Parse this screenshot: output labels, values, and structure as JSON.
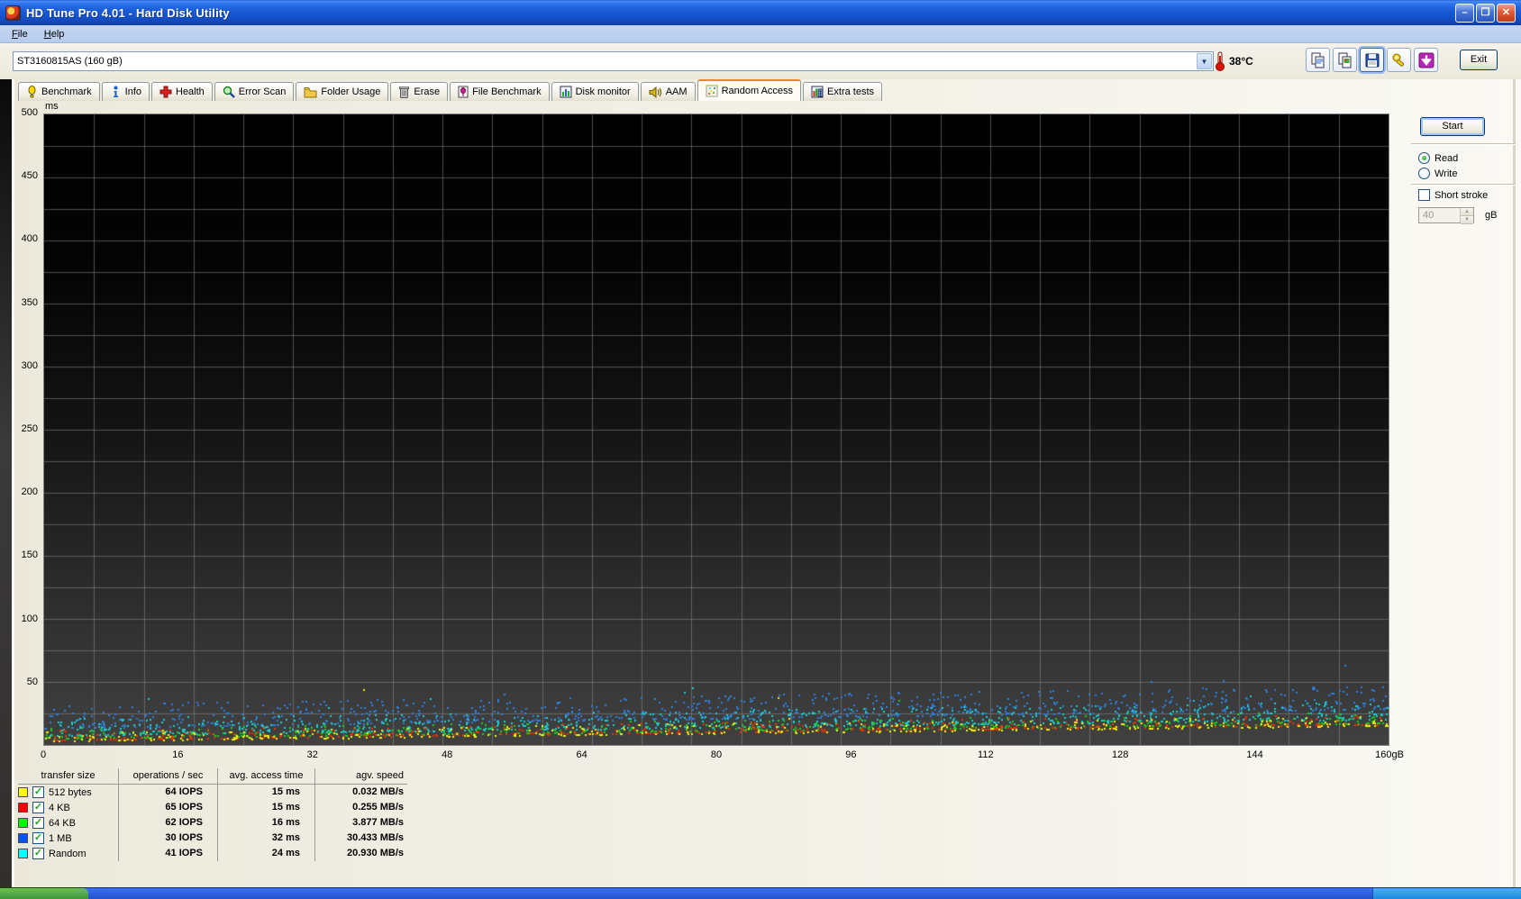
{
  "window": {
    "title": "HD Tune Pro 4.01 - Hard Disk Utility",
    "icons": {
      "app": "hdtune-app-icon",
      "minimize": "minimize-icon",
      "maximize": "maximize-icon",
      "close": "close-icon"
    },
    "glyphs": {
      "minimize": "–",
      "maximize": "❐",
      "close": "✕"
    }
  },
  "menu": {
    "items": [
      {
        "label": "File"
      },
      {
        "label": "Help"
      }
    ]
  },
  "toolbar": {
    "drive_selector": {
      "value": "ST3160815AS (160 gB)"
    },
    "temperature": "38°C",
    "buttons": [
      "copy-text",
      "copy-image",
      "save",
      "options",
      "export"
    ],
    "exit_label": "Exit"
  },
  "tabs": [
    {
      "label": "Benchmark",
      "active": false
    },
    {
      "label": "Info",
      "active": false
    },
    {
      "label": "Health",
      "active": false
    },
    {
      "label": "Error Scan",
      "active": false
    },
    {
      "label": "Folder Usage",
      "active": false
    },
    {
      "label": "Erase",
      "active": false
    },
    {
      "label": "File Benchmark",
      "active": false
    },
    {
      "label": "Disk monitor",
      "active": false
    },
    {
      "label": "AAM",
      "active": false
    },
    {
      "label": "Random Access",
      "active": true
    },
    {
      "label": "Extra tests",
      "active": false
    }
  ],
  "controls": {
    "start_label": "Start",
    "read_label": "Read",
    "write_label": "Write",
    "read_selected": true,
    "short_stroke_label": "Short stroke",
    "short_stroke_checked": false,
    "stroke_value": "40",
    "stroke_unit": "gB"
  },
  "chart_data": {
    "type": "scatter",
    "title": "Random access time vs disk position",
    "y": {
      "label": "ms",
      "min": 0,
      "max": 500,
      "tick_step": 50,
      "grid_step": 25,
      "ticks": [
        500,
        450,
        400,
        350,
        300,
        250,
        200,
        150,
        100,
        50
      ]
    },
    "x": {
      "min": 0,
      "max": 160,
      "tick_step": 16,
      "unit": "gB",
      "ticks": [
        0,
        16,
        32,
        48,
        64,
        80,
        96,
        112,
        128,
        144
      ],
      "end_label": "160gB"
    },
    "grid": {
      "v_divisions": 27,
      "color": "rgba(138,138,138,0.55)"
    },
    "bg_gradient": [
      "#000000",
      "#050505",
      "#141414",
      "#2c2c2c",
      "#414141"
    ],
    "series": [
      {
        "name": "512 bytes",
        "color": "#f2f20e",
        "points": 450,
        "base_start": 2.5,
        "base_end": 15,
        "spread": 8,
        "pow": 2.5,
        "outlier_rate": 0.006,
        "outlier_boost": 35
      },
      {
        "name": "4 KB",
        "color": "#f03000",
        "points": 450,
        "base_start": 3.5,
        "base_end": 16,
        "spread": 8,
        "pow": 2.5,
        "outlier_rate": 0.006,
        "outlier_boost": 35
      },
      {
        "name": "64 KB",
        "color": "#1ad01a",
        "points": 450,
        "base_start": 4.5,
        "base_end": 17,
        "spread": 9,
        "pow": 2.5,
        "outlier_rate": 0.008,
        "outlier_boost": 35
      },
      {
        "name": "1 MB",
        "color": "#2e7fdd",
        "points": 850,
        "base_start": 13,
        "base_end": 28,
        "spread": 19,
        "pow": 1.8,
        "outlier_rate": 0.01,
        "outlier_boost": 28
      },
      {
        "name": "Random",
        "color": "#17cfcf",
        "points": 850,
        "base_start": 7,
        "base_end": 20,
        "spread": 14,
        "pow": 2.0,
        "outlier_rate": 0.008,
        "outlier_boost": 28
      }
    ],
    "draw_order": [
      3,
      4,
      2,
      1,
      0
    ]
  },
  "legend_table": {
    "headers": [
      "transfer size",
      "operations / sec",
      "avg. access time",
      "agv. speed"
    ],
    "rows": [
      {
        "color": "#ffff00",
        "checked": true,
        "label": "512 bytes",
        "iops": "64 IOPS",
        "access": "15 ms",
        "speed": "0.032 MB/s"
      },
      {
        "color": "#ff0000",
        "checked": true,
        "label": "4 KB",
        "iops": "65 IOPS",
        "access": "15 ms",
        "speed": "0.255 MB/s"
      },
      {
        "color": "#00ff00",
        "checked": true,
        "label": "64 KB",
        "iops": "62 IOPS",
        "access": "16 ms",
        "speed": "3.877 MB/s"
      },
      {
        "color": "#0055ff",
        "checked": true,
        "label": "1 MB",
        "iops": "30 IOPS",
        "access": "32 ms",
        "speed": "30.433 MB/s"
      },
      {
        "color": "#00ffff",
        "checked": true,
        "label": "Random",
        "iops": "41 IOPS",
        "access": "24 ms",
        "speed": "20.930 MB/s"
      }
    ],
    "check_glyph": "✓"
  }
}
